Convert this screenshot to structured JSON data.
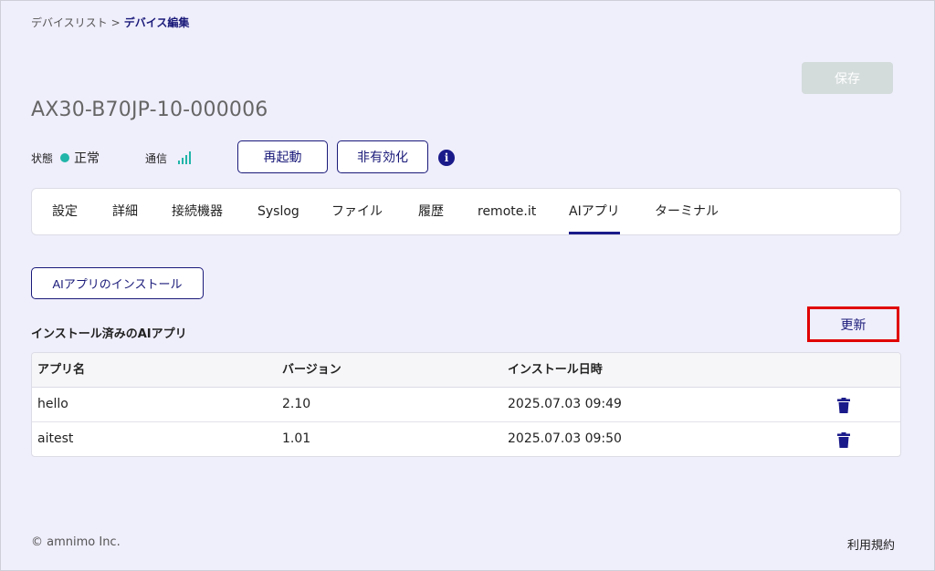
{
  "breadcrumb": {
    "parent": "デバイスリスト",
    "separator": ">",
    "current": "デバイス編集"
  },
  "toolbar": {
    "save_label": "保存"
  },
  "device": {
    "name": "AX30-B70JP-10-000006"
  },
  "status": {
    "state_label": "状態",
    "state_value": "正常",
    "state_color": "#20b5a8",
    "comm_label": "通信",
    "signal_bars": 4,
    "signal_max": 4
  },
  "actions": {
    "restart_label": "再起動",
    "disable_label": "非有効化",
    "info_icon": "i"
  },
  "tabs": [
    {
      "label": "設定"
    },
    {
      "label": "詳細"
    },
    {
      "label": "接続機器"
    },
    {
      "label": "Syslog"
    },
    {
      "label": "ファイル"
    },
    {
      "label": "履歴"
    },
    {
      "label": "remote.it"
    },
    {
      "label": "AIアプリ",
      "active": true
    },
    {
      "label": "ターミナル"
    }
  ],
  "ai_apps": {
    "install_label": "AIアプリのインストール",
    "section_title": "インストール済みのAIアプリ",
    "refresh_label": "更新",
    "columns": [
      "アプリ名",
      "バージョン",
      "インストール日時"
    ],
    "rows": [
      {
        "name": "hello",
        "version": "2.10",
        "installed": "2025.07.03 09:49"
      },
      {
        "name": "aitest",
        "version": "1.01",
        "installed": "2025.07.03 09:50"
      }
    ]
  },
  "footer": {
    "copyright": "© amnimo Inc.",
    "terms": "利用規約"
  },
  "colors": {
    "accent": "#1a1a7a",
    "highlight": "#e00000",
    "background": "#efeefb"
  }
}
